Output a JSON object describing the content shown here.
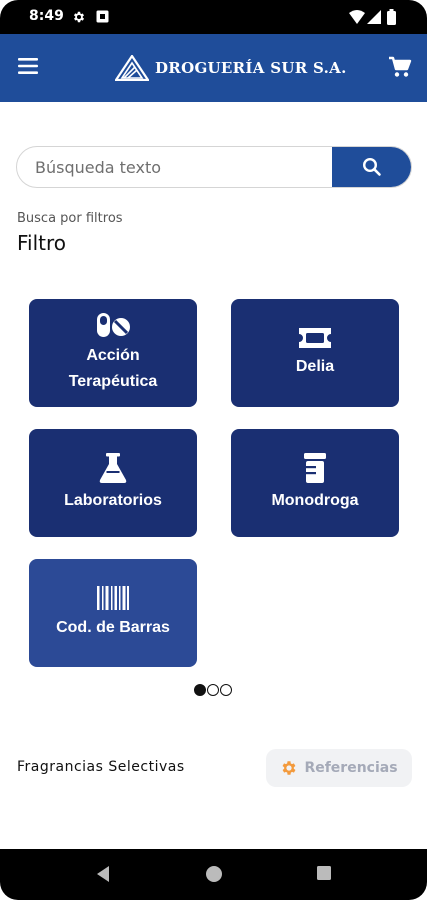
{
  "status_bar": {
    "time": "8:49",
    "left_icons": [
      "settings-icon",
      "notification-icon"
    ],
    "right_icons": [
      "wifi-icon",
      "signal-icon",
      "battery-icon"
    ]
  },
  "app_bar": {
    "brand": "DROGUERÍA SUR S.A.",
    "menu_icon": "menu-icon",
    "cart_icon": "cart-icon",
    "color": "#1f4d9a"
  },
  "search": {
    "placeholder": "Búsqueda texto",
    "value": "",
    "button_icon": "search-icon"
  },
  "filters": {
    "subtitle": "Busca por filtros",
    "title": "Filtro",
    "tiles": [
      {
        "label": "Acción Terapéutica",
        "icon": "pills-icon"
      },
      {
        "label": "Delia",
        "icon": "ticket-icon"
      },
      {
        "label": "Laboratorios",
        "icon": "flask-icon"
      },
      {
        "label": "Monodroga",
        "icon": "prescription-bottle-icon"
      },
      {
        "label": "Cod. de Barras",
        "icon": "barcode-icon"
      }
    ],
    "tile_color": "#1a2f72",
    "pager": {
      "pages": 3,
      "current": 1
    }
  },
  "footer": {
    "section_label": "Fragrancias Selectivas",
    "reference_button": "Referencias",
    "reference_icon": "gear-icon",
    "reference_icon_color": "#f39a3c"
  },
  "nav_bar": {
    "buttons": [
      "back-icon",
      "home-icon",
      "recents-icon"
    ]
  }
}
